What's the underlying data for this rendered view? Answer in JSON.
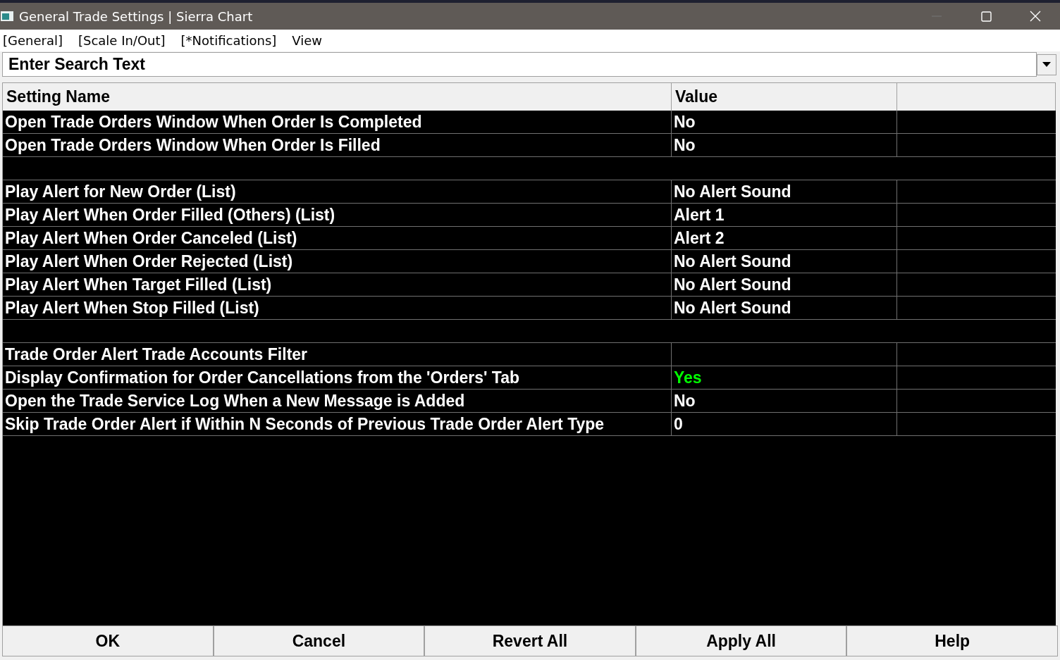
{
  "window": {
    "title": "General Trade Settings | Sierra Chart"
  },
  "menu": [
    "[General]",
    "[Scale In/Out]",
    "[*Notifications]",
    "View"
  ],
  "search": {
    "placeholder": "Enter Search Text"
  },
  "table": {
    "columns": [
      "Setting Name",
      "Value"
    ],
    "rows": [
      {
        "kind": "setting",
        "name": "Open Trade Orders Window When Order Is Completed",
        "value": "No"
      },
      {
        "kind": "setting",
        "name": "Open Trade Orders Window When Order Is Filled",
        "value": "No"
      },
      {
        "kind": "blank"
      },
      {
        "kind": "setting",
        "name": "Play Alert for New Order (List)",
        "value": "No Alert Sound"
      },
      {
        "kind": "setting",
        "name": "Play Alert When Order Filled (Others) (List)",
        "value": "Alert 1"
      },
      {
        "kind": "setting",
        "name": "Play Alert When Order Canceled (List)",
        "value": "Alert 2"
      },
      {
        "kind": "setting",
        "name": "Play Alert When Order Rejected (List)",
        "value": "No Alert Sound"
      },
      {
        "kind": "setting",
        "name": "Play Alert When Target Filled (List)",
        "value": "No Alert Sound"
      },
      {
        "kind": "setting",
        "name": "Play Alert When Stop Filled (List)",
        "value": "No Alert Sound"
      },
      {
        "kind": "blank"
      },
      {
        "kind": "setting",
        "name": "Trade Order Alert Trade Accounts Filter"
      },
      {
        "kind": "setting",
        "name": "Display Confirmation for Order Cancellations from the 'Orders' Tab",
        "value": "Yes",
        "color": "#00ff00"
      },
      {
        "kind": "setting",
        "name": "Open the Trade Service Log When a New Message is Added",
        "value": "No"
      },
      {
        "kind": "setting",
        "name": "Skip Trade Order Alert if Within N Seconds of Previous Trade Order Alert Type",
        "value": "0"
      }
    ]
  },
  "buttons": [
    "OK",
    "Cancel",
    "Revert All",
    "Apply All",
    "Help"
  ]
}
